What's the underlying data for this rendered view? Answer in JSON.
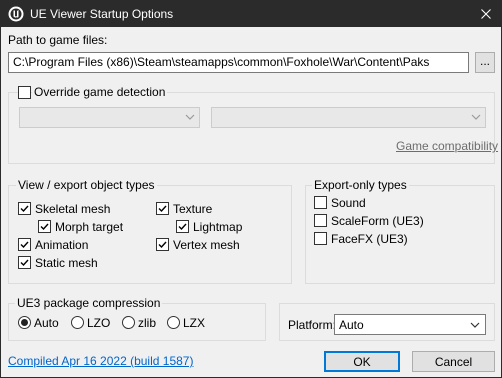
{
  "window": {
    "title": "UE Viewer Startup Options",
    "app_icon": "unreal-engine-icon",
    "close_icon": "close-icon"
  },
  "path": {
    "label": "Path to game files:",
    "value": "C:\\Program Files (x86)\\Steam\\steamapps\\common\\Foxhole\\War\\Content\\Paks",
    "browse_label": "..."
  },
  "override": {
    "label": "Override game detection",
    "checked": false,
    "game_combo_value": "",
    "platform_combo_value": "",
    "compat_link": "Game compatibility"
  },
  "view_export": {
    "title": "View / export object types",
    "items": [
      {
        "label": "Skeletal mesh",
        "checked": true
      },
      {
        "label": "Morph target",
        "checked": true
      },
      {
        "label": "Animation",
        "checked": true
      },
      {
        "label": "Static mesh",
        "checked": true
      },
      {
        "label": "Texture",
        "checked": true
      },
      {
        "label": "Lightmap",
        "checked": true
      },
      {
        "label": "Vertex mesh",
        "checked": true
      }
    ]
  },
  "export_only": {
    "title": "Export-only types",
    "items": [
      {
        "label": "Sound",
        "checked": false
      },
      {
        "label": "ScaleForm (UE3)",
        "checked": false
      },
      {
        "label": "FaceFX (UE3)",
        "checked": false
      }
    ]
  },
  "compression": {
    "title": "UE3 package compression",
    "options": [
      {
        "label": "Auto",
        "selected": true
      },
      {
        "label": "LZO",
        "selected": false
      },
      {
        "label": "zlib",
        "selected": false
      },
      {
        "label": "LZX",
        "selected": false
      }
    ]
  },
  "platform": {
    "label": "Platform:",
    "value": "Auto"
  },
  "footer": {
    "build_link": "Compiled Apr 16 2022 (build 1587)",
    "ok_label": "OK",
    "cancel_label": "Cancel"
  }
}
